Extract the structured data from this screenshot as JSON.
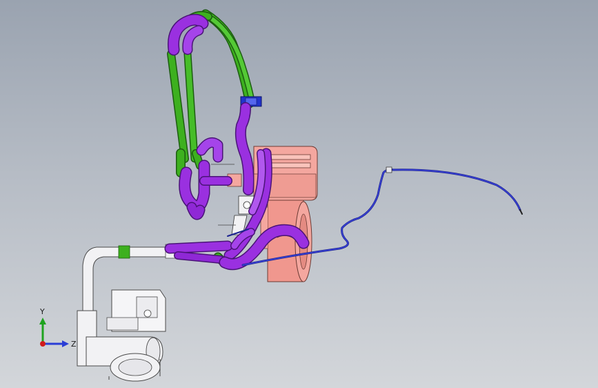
{
  "viewport": {
    "background_top": "#9aa3b0",
    "background_bottom": "#d3d6da"
  },
  "triad": {
    "y_label": "Y",
    "z_label": "Z",
    "y_color": "#1fa31f",
    "z_color": "#2a3dd6",
    "x_color": "#d01b1b"
  },
  "model": {
    "parts": [
      {
        "name": "engine-block",
        "color": "#f4a79f"
      },
      {
        "name": "purple-hoses",
        "color": "#9a30e0"
      },
      {
        "name": "green-hoses",
        "color": "#3db01f"
      },
      {
        "name": "blue-cable",
        "color": "#2a2fb5"
      },
      {
        "name": "blue-clamp",
        "color": "#2233cc"
      },
      {
        "name": "white-pipes",
        "color": "#f2f2f4"
      }
    ]
  }
}
